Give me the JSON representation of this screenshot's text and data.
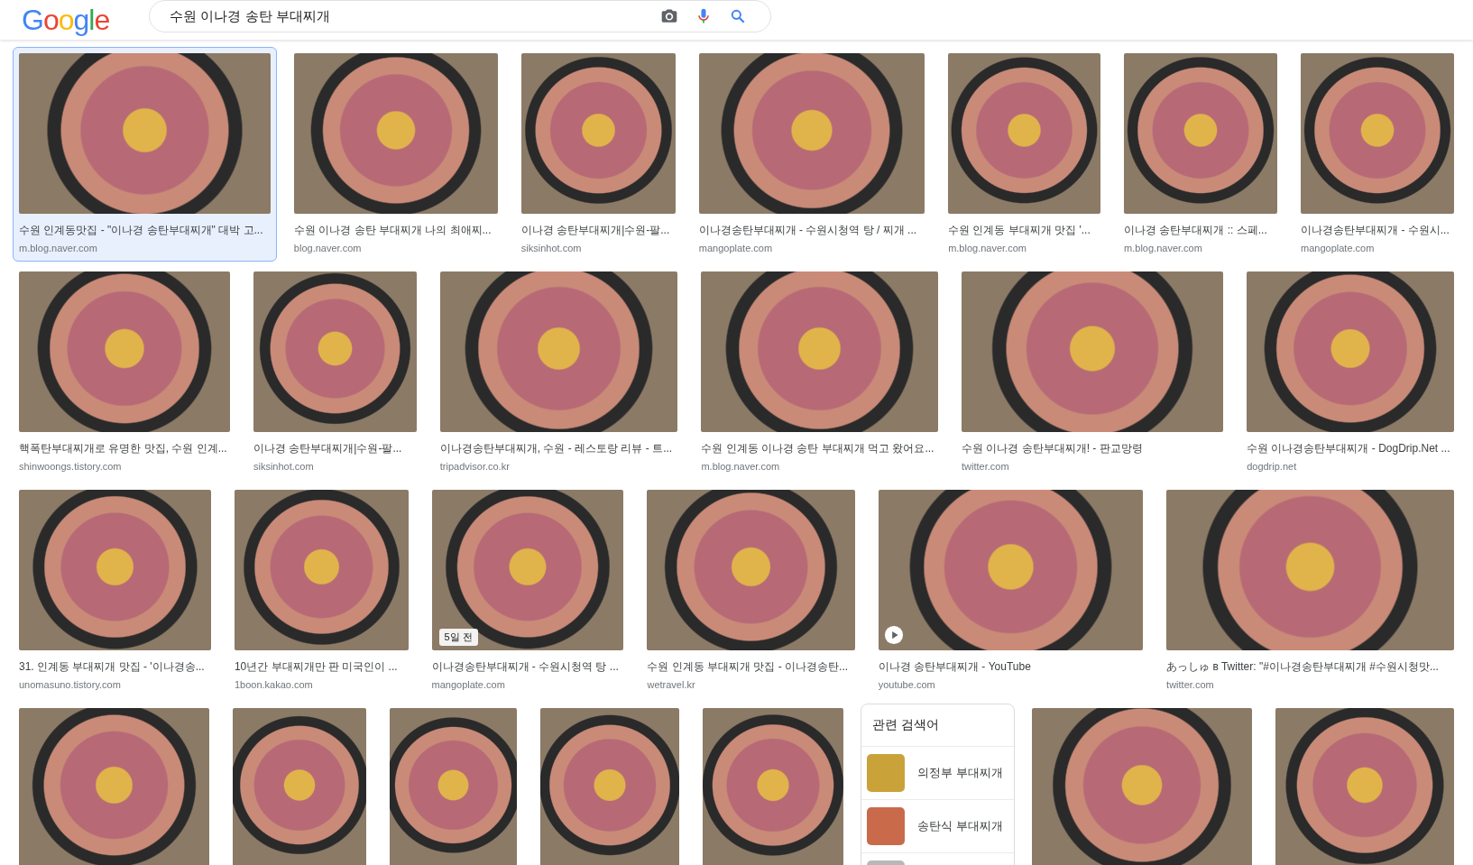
{
  "header": {
    "logo": "Google",
    "search": {
      "value": "수원 이나경 송탄 부대찌개"
    }
  },
  "rows": [
    {
      "items": [
        {
          "kind": "image",
          "selected": true,
          "title": "수원 인계동맛집 - \"이나경 송탄부대찌개\" 대박 고...",
          "source": "m.blog.naver.com"
        },
        {
          "kind": "image",
          "selected": false,
          "title": "수원 이나경 송탄 부대찌개 나의 최애찌...",
          "source": "blog.naver.com"
        },
        {
          "kind": "image",
          "selected": false,
          "title": "이나경 송탄부대찌개|수원-팔...",
          "source": "siksinhot.com"
        },
        {
          "kind": "image",
          "selected": false,
          "title": "이나경송탄부대찌개 - 수원시청역 탕 / 찌개 ...",
          "source": "mangoplate.com"
        },
        {
          "kind": "image",
          "selected": false,
          "title": "수원 인계동 부대찌개 맛집 '...",
          "source": "m.blog.naver.com"
        },
        {
          "kind": "image",
          "selected": false,
          "title": "이나경 송탄부대찌개 :: 스페...",
          "source": "m.blog.naver.com"
        },
        {
          "kind": "image",
          "selected": false,
          "title": "이나경송탄부대찌개 - 수원시...",
          "source": "mangoplate.com"
        }
      ]
    },
    {
      "items": [
        {
          "kind": "image",
          "selected": false,
          "title": "핵폭탄부대찌개로 유명한 맛집, 수원 인계...",
          "source": "shinwoongs.tistory.com"
        },
        {
          "kind": "image",
          "selected": false,
          "title": "이나경 송탄부대찌개|수원-팔...",
          "source": "siksinhot.com"
        },
        {
          "kind": "image",
          "selected": false,
          "title": "이나경송탄부대찌개, 수원 - 레스토랑 리뷰 - 트...",
          "source": "tripadvisor.co.kr"
        },
        {
          "kind": "image",
          "selected": false,
          "title": "수원 인계동 이나경 송탄 부대찌개 먹고 왔어요...",
          "source": "m.blog.naver.com"
        },
        {
          "kind": "image",
          "selected": false,
          "title": "수원 이나경 송탄부대찌개! - 판교망령",
          "source": "twitter.com"
        },
        {
          "kind": "image",
          "selected": false,
          "title": "수원 이나경송탄부대찌개 - DogDrip.Net ...",
          "source": "dogdrip.net"
        }
      ]
    },
    {
      "items": [
        {
          "kind": "image",
          "selected": false,
          "title": "31. 인계동 부대찌개 맛집 - '이나경송...",
          "source": "unomasuno.tistory.com"
        },
        {
          "kind": "image",
          "selected": false,
          "title": "10년간 부대찌개만 판 미국인이 ...",
          "source": "1boon.kakao.com"
        },
        {
          "kind": "image",
          "selected": false,
          "badge": "5일 전",
          "title": "이나경송탄부대찌개 - 수원시청역 탕 ...",
          "source": "mangoplate.com"
        },
        {
          "kind": "image",
          "selected": false,
          "title": "수원 인계동 부대찌개 맛집 - 이나경송탄...",
          "source": "wetravel.kr"
        },
        {
          "kind": "video",
          "selected": false,
          "title": "이나경 송탄부대찌개 - YouTube",
          "source": "youtube.com"
        },
        {
          "kind": "image",
          "selected": false,
          "title": "あっしゅ ʙ Twitter: \"#이나경송탄부대찌개 #수원시청맛...",
          "source": "twitter.com"
        }
      ]
    },
    {
      "items": [
        {
          "kind": "image",
          "selected": false
        },
        {
          "kind": "image",
          "selected": false
        },
        {
          "kind": "image",
          "selected": false
        },
        {
          "kind": "image",
          "selected": false
        },
        {
          "kind": "image",
          "selected": false
        },
        {
          "kind": "related",
          "title": "관련 검색어",
          "searches": [
            "의정부 부대찌개",
            "송탄식 부대찌개"
          ]
        },
        {
          "kind": "image",
          "selected": false
        },
        {
          "kind": "image",
          "selected": false
        }
      ]
    }
  ]
}
